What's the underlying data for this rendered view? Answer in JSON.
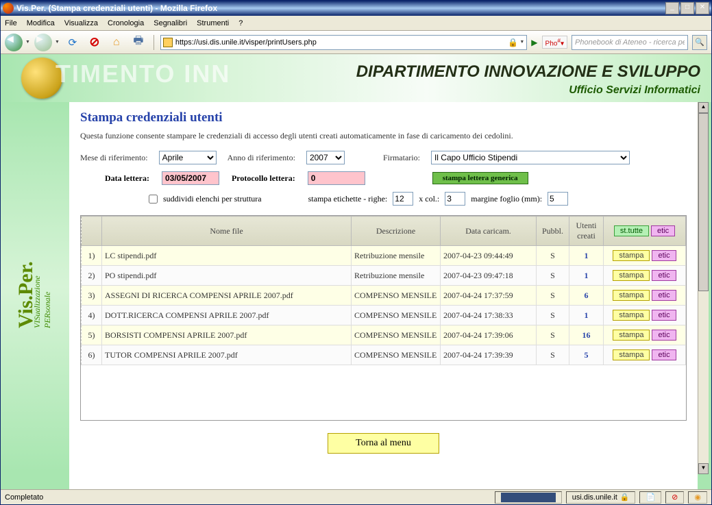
{
  "window": {
    "title": "Vis.Per. (Stampa credenziali utenti) - Mozilla Firefox"
  },
  "menubar": [
    "File",
    "Modifica",
    "Visualizza",
    "Cronologia",
    "Segnalibri",
    "Strumenti",
    "?"
  ],
  "toolbar": {
    "url": "https://usi.dis.unile.it/visper/printUsers.php",
    "phobadge": "Pho",
    "search_placeholder": "Phonebook di Ateneo - ricerca pe"
  },
  "header": {
    "watermark": "TIMENTO INN",
    "department": "DIPARTIMENTO INNOVAZIONE E SVILUPPO",
    "office": "Ufficio Servizi Informatici"
  },
  "sidebar": {
    "title": "Vis.Per.",
    "subtitle": "VISualizzazione PERsonale"
  },
  "page": {
    "title": "Stampa credenziali utenti",
    "description": "Questa funzione consente stampare le credenziali di accesso degli utenti creati automaticamente in fase di caricamento dei cedolini."
  },
  "filters": {
    "mese_label": "Mese di riferimento:",
    "mese_value": "Aprile",
    "anno_label": "Anno di riferimento:",
    "anno_value": "2007",
    "firmatario_label": "Firmatario:",
    "firmatario_value": "Il Capo Ufficio Stipendi"
  },
  "row2": {
    "data_lettera_label": "Data lettera:",
    "data_lettera_value": "03/05/2007",
    "protocollo_label": "Protocollo lettera:",
    "protocollo_value": "0",
    "generic_btn": "stampa lettera generica"
  },
  "row3": {
    "suddividi_label": "suddividi elenchi per struttura",
    "etichette_label": "stampa etichette - righe:",
    "righe": "12",
    "xcol_label": "x col.:",
    "col": "3",
    "margine_label": "margine foglio (mm):",
    "margine": "5"
  },
  "table": {
    "headers": {
      "nome": "Nome file",
      "descr": "Descrizione",
      "data": "Data caricam.",
      "pubbl": "Pubbl.",
      "utenti": "Utenti creati",
      "sttutte": "st.tutte",
      "etic": "etic"
    },
    "stampa_btn": "stampa",
    "etic_btn": "etic",
    "rows": [
      {
        "n": "1)",
        "nome": "LC stipendi.pdf",
        "descr": "Retribuzione mensile",
        "data": "2007-04-23 09:44:49",
        "pubbl": "S",
        "utenti": "1"
      },
      {
        "n": "2)",
        "nome": "PO stipendi.pdf",
        "descr": "Retribuzione mensile",
        "data": "2007-04-23 09:47:18",
        "pubbl": "S",
        "utenti": "1"
      },
      {
        "n": "3)",
        "nome": "ASSEGNI DI RICERCA COMPENSI APRILE 2007.pdf",
        "descr": "COMPENSO MENSILE",
        "data": "2007-04-24 17:37:59",
        "pubbl": "S",
        "utenti": "6"
      },
      {
        "n": "4)",
        "nome": "DOTT.RICERCA COMPENSI APRILE 2007.pdf",
        "descr": "COMPENSO MENSILE",
        "data": "2007-04-24 17:38:33",
        "pubbl": "S",
        "utenti": "1"
      },
      {
        "n": "5)",
        "nome": "BORSISTI COMPENSI APRILE 2007.pdf",
        "descr": "COMPENSO MENSILE",
        "data": "2007-04-24 17:39:06",
        "pubbl": "S",
        "utenti": "16"
      },
      {
        "n": "6)",
        "nome": "TUTOR COMPENSI APRILE 2007.pdf",
        "descr": "COMPENSO MENSILE",
        "data": "2007-04-24 17:39:39",
        "pubbl": "S",
        "utenti": "5"
      }
    ]
  },
  "back_btn": "Torna al menu",
  "statusbar": {
    "status": "Completato",
    "domain": "usi.dis.unile.it"
  }
}
